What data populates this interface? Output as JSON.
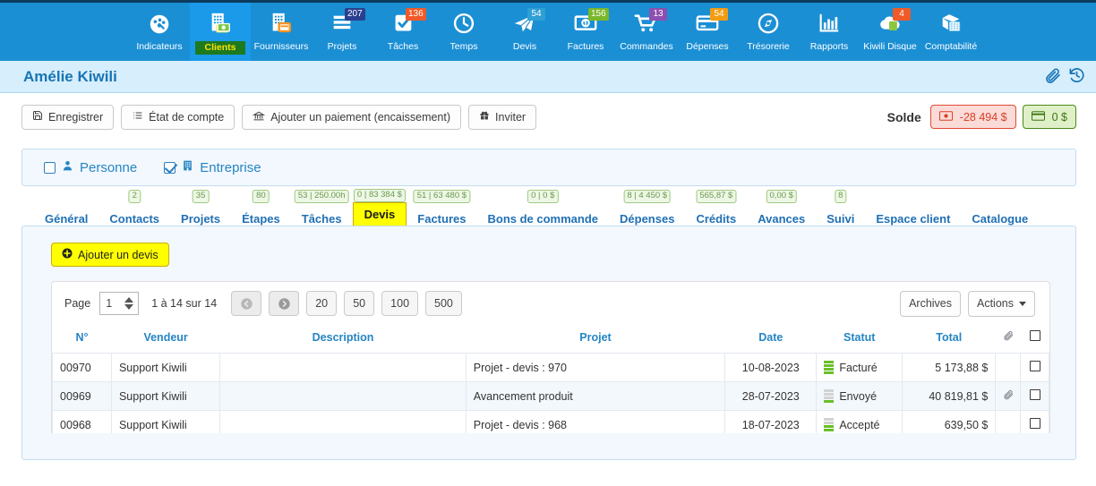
{
  "topnav": {
    "items": [
      {
        "label": "Indicateurs",
        "icon": "dashboard-icon",
        "badge": null,
        "badge_color": null,
        "active": false
      },
      {
        "label": "Clients",
        "icon": "building-money-icon",
        "badge": null,
        "badge_color": null,
        "active": true
      },
      {
        "label": "Fournisseurs",
        "icon": "building-card-icon",
        "badge": null,
        "badge_color": null,
        "active": false
      },
      {
        "label": "Projets",
        "icon": "list-icon",
        "badge": "207",
        "badge_color": "#2a3f8f",
        "active": false
      },
      {
        "label": "Tâches",
        "icon": "check-square-icon",
        "badge": "136",
        "badge_color": "#f05a28",
        "active": false
      },
      {
        "label": "Temps",
        "icon": "clock-icon",
        "badge": null,
        "badge_color": null,
        "active": false
      },
      {
        "label": "Devis",
        "icon": "paper-plane-icon",
        "badge": "54",
        "badge_color": "#2f9fd4",
        "active": false
      },
      {
        "label": "Factures",
        "icon": "banknote-icon",
        "badge": "156",
        "badge_color": "#7ab72b",
        "active": false
      },
      {
        "label": "Commandes",
        "icon": "cart-icon",
        "badge": "13",
        "badge_color": "#8d4fb0",
        "active": false
      },
      {
        "label": "Dépenses",
        "icon": "credit-card-icon",
        "badge": "54",
        "badge_color": "#f39c12",
        "active": false
      },
      {
        "label": "Trésorerie",
        "icon": "compass-icon",
        "badge": null,
        "badge_color": null,
        "active": false
      },
      {
        "label": "Rapports",
        "icon": "bar-chart-icon",
        "badge": null,
        "badge_color": null,
        "active": false
      },
      {
        "label": "Kiwili Disque",
        "icon": "cloud-folder-icon",
        "badge": "4",
        "badge_color": "#f05a28",
        "active": false
      },
      {
        "label": "Comptabilité",
        "icon": "calculator-icon",
        "badge": null,
        "badge_color": null,
        "active": false
      }
    ]
  },
  "header": {
    "title": "Amélie Kiwili",
    "attachment_icon": "paperclip-icon",
    "history_icon": "history-icon"
  },
  "toolbar": {
    "save_label": "Enregistrer",
    "statement_label": "État de compte",
    "payment_label": "Ajouter un paiement (encaissement)",
    "invite_label": "Inviter",
    "balance_label": "Solde",
    "balance_negative": "-28 494 $",
    "balance_positive": "0 $"
  },
  "type_panel": {
    "person_label": "Personne",
    "person_checked": false,
    "company_label": "Entreprise",
    "company_checked": true
  },
  "tabs": [
    {
      "label": "Général",
      "badge": null,
      "active": false
    },
    {
      "label": "Contacts",
      "badge": "2",
      "active": false
    },
    {
      "label": "Projets",
      "badge": "35",
      "active": false
    },
    {
      "label": "Étapes",
      "badge": "80",
      "active": false
    },
    {
      "label": "Tâches",
      "badge": "53 | 250.00h",
      "active": false
    },
    {
      "label": "Devis",
      "badge": "0 | 83 384 $",
      "active": true
    },
    {
      "label": "Factures",
      "badge": "51 | 63 480 $",
      "active": false
    },
    {
      "label": "Bons de commande",
      "badge": "0 | 0 $",
      "active": false
    },
    {
      "label": "Dépenses",
      "badge": "8 | 4 450 $",
      "active": false
    },
    {
      "label": "Crédits",
      "badge": "565,87 $",
      "active": false
    },
    {
      "label": "Avances",
      "badge": "0,00 $",
      "active": false
    },
    {
      "label": "Suivi",
      "badge": "8",
      "active": false
    },
    {
      "label": "Espace client",
      "badge": null,
      "active": false
    },
    {
      "label": "Catalogue",
      "badge": null,
      "active": false
    }
  ],
  "main": {
    "add_button_label": "Ajouter un devis",
    "pagination": {
      "page_label": "Page",
      "page_value": "1",
      "range_label": "1 à 14 sur 14",
      "prev_icon": "arrow-left-circle-icon",
      "next_icon": "arrow-right-circle-icon",
      "sizes": [
        "20",
        "50",
        "100",
        "500"
      ],
      "archives_label": "Archives",
      "actions_label": "Actions"
    },
    "table": {
      "columns": [
        "N°",
        "Vendeur",
        "Description",
        "Projet",
        "Date",
        "Statut",
        "Total",
        "",
        ""
      ],
      "header_clip_icon": "paperclip-icon",
      "header_select_all": "select-all-checkbox",
      "rows": [
        {
          "number": "00970",
          "vendor": "Support Kiwili",
          "description": "",
          "project": "Projet - devis : 970",
          "date": "10-08-2023",
          "status": "Facturé",
          "status_level": 4,
          "total": "5 173,88 $",
          "has_attachment": false
        },
        {
          "number": "00969",
          "vendor": "Support Kiwili",
          "description": "",
          "project": "Avancement produit",
          "date": "28-07-2023",
          "status": "Envoyé",
          "status_level": 1,
          "total": "40 819,81 $",
          "has_attachment": true
        },
        {
          "number": "00968",
          "vendor": "Support Kiwili",
          "description": "",
          "project": "Projet - devis : 968",
          "date": "18-07-2023",
          "status": "Accepté",
          "status_level": 2,
          "total": "639,50 $",
          "has_attachment": false
        }
      ]
    }
  },
  "colors": {
    "nav_bg": "#1b8fd4",
    "nav_active": "#1a9ae8",
    "active_label_bg": "#1e7a1e",
    "active_label_fg": "#ffe000",
    "header_band": "#d7eefc",
    "panel_bg": "#f2f8fd",
    "accent_blue": "#2585c4",
    "highlight_yellow": "#ffff00",
    "status_green": "#6abf2a",
    "status_gray": "#d3d3d3"
  }
}
